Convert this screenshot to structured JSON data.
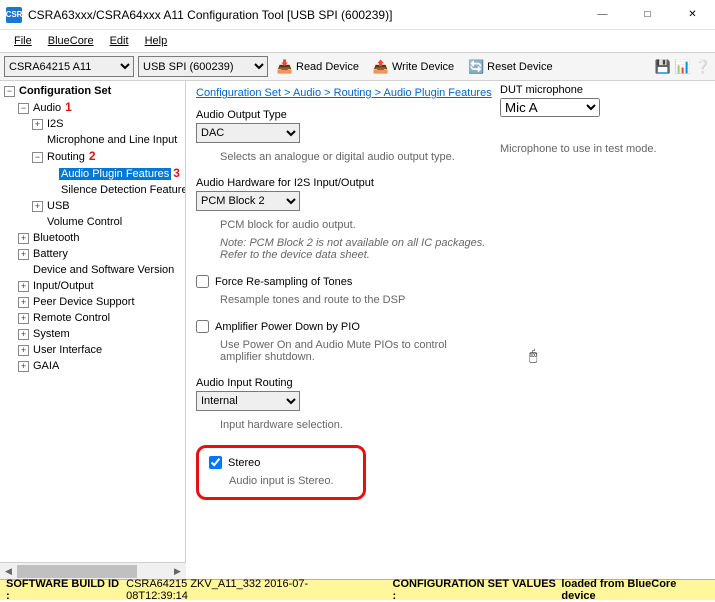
{
  "window": {
    "title": "CSRA63xxx/CSRA64xxx A11 Configuration Tool [USB SPI (600239)]",
    "app_badge": "CSR"
  },
  "menu": {
    "file": "File",
    "bluecore": "BlueCore",
    "edit": "Edit",
    "help": "Help"
  },
  "toolbar": {
    "chip_select": "CSRA64215 A11",
    "port_select": "USB SPI (600239)",
    "read": "Read Device",
    "write": "Write Device",
    "reset": "Reset Device"
  },
  "tree": {
    "root": "Configuration Set",
    "audio": "Audio",
    "i2s": "I2S",
    "mic_line": "Microphone and Line Input",
    "routing": "Routing",
    "apf": "Audio Plugin Features",
    "silence": "Silence Detection Feature",
    "usb": "USB",
    "vol": "Volume Control",
    "bt": "Bluetooth",
    "batt": "Battery",
    "devsw": "Device and Software Version",
    "io": "Input/Output",
    "peer": "Peer Device Support",
    "remote": "Remote Control",
    "system": "System",
    "ui": "User Interface",
    "gaia": "GAIA",
    "ann1": "1",
    "ann2": "2",
    "ann3": "3"
  },
  "breadcrumb": {
    "a": "Configuration Set",
    "b": "Audio",
    "c": "Routing",
    "d": "Audio Plugin Features",
    "sep": " > "
  },
  "content": {
    "output_type_label": "Audio Output Type",
    "output_type_value": "DAC",
    "output_type_help": "Selects an analogue or digital audio output type.",
    "hw_label": "Audio Hardware for I2S Input/Output",
    "hw_value": "PCM Block 2",
    "hw_help1": "PCM block for audio output.",
    "hw_help2": "Note: PCM Block 2 is not available on all IC packages. Refer to the device data sheet.",
    "force_label": "Force Re-sampling of Tones",
    "force_help": "Resample tones and route to the DSP",
    "amp_label": "Amplifier Power Down by PIO",
    "amp_help": "Use Power On and Audio Mute PIOs to control amplifier shutdown.",
    "input_routing_label": "Audio Input Routing",
    "input_routing_value": "Internal",
    "input_routing_help": "Input hardware selection.",
    "stereo_label": "Stereo",
    "stereo_help": "Audio input is Stereo."
  },
  "dut": {
    "label": "DUT microphone",
    "value": "Mic A",
    "help": "Microphone to use in test mode."
  },
  "status": {
    "build_label": "SOFTWARE BUILD ID :",
    "build_value": "CSRA64215 ZKV_A11_332 2016-07-08T12:39:14",
    "config_label": "CONFIGURATION SET VALUES :",
    "config_value": "loaded from BlueCore device"
  }
}
